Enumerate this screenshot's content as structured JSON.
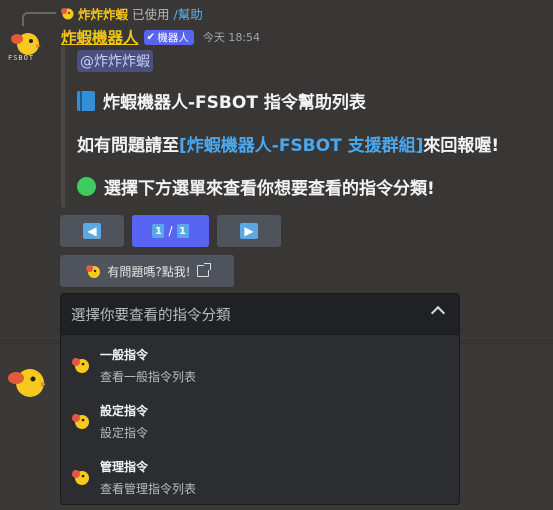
{
  "reply": {
    "author": "炸炸炸蝦",
    "used_text": "已使用",
    "command": "/幫助"
  },
  "avatar": {
    "label": "FSBOT"
  },
  "message": {
    "author": "炸蝦機器人",
    "bot_tag": "機器人",
    "timestamp": "今天 18:54",
    "mention": "@炸炸炸蝦"
  },
  "embed": {
    "title": "炸蝦機器人-FSBOT 指令幫助列表",
    "line2_prefix": "如有問題請至",
    "line2_link": "[炸蝦機器人-FSBOT 支援群組]",
    "line2_suffix": "來回報喔!",
    "line3": "選擇下方選單來查看你想要查看的指令分類!"
  },
  "pagination": {
    "prev_icon": "left-arrow-icon",
    "current": "1",
    "separator": "/",
    "total": "1",
    "next_icon": "right-arrow-icon"
  },
  "help_button": {
    "label": "有問題嗎?點我!",
    "icon": "external-link-icon"
  },
  "select": {
    "placeholder": "選擇你要查看的指令分類",
    "options": [
      {
        "title": "一般指令",
        "description": "查看一般指令列表"
      },
      {
        "title": "設定指令",
        "description": "設定指令"
      },
      {
        "title": "管理指令",
        "description": "查看管理指令列表"
      }
    ]
  },
  "colors": {
    "username": "#f0c419",
    "bot_tag": "#5865f2",
    "link": "#4aa8f0",
    "page_button": "#5865f2",
    "green_dot": "#3ecb5f"
  }
}
